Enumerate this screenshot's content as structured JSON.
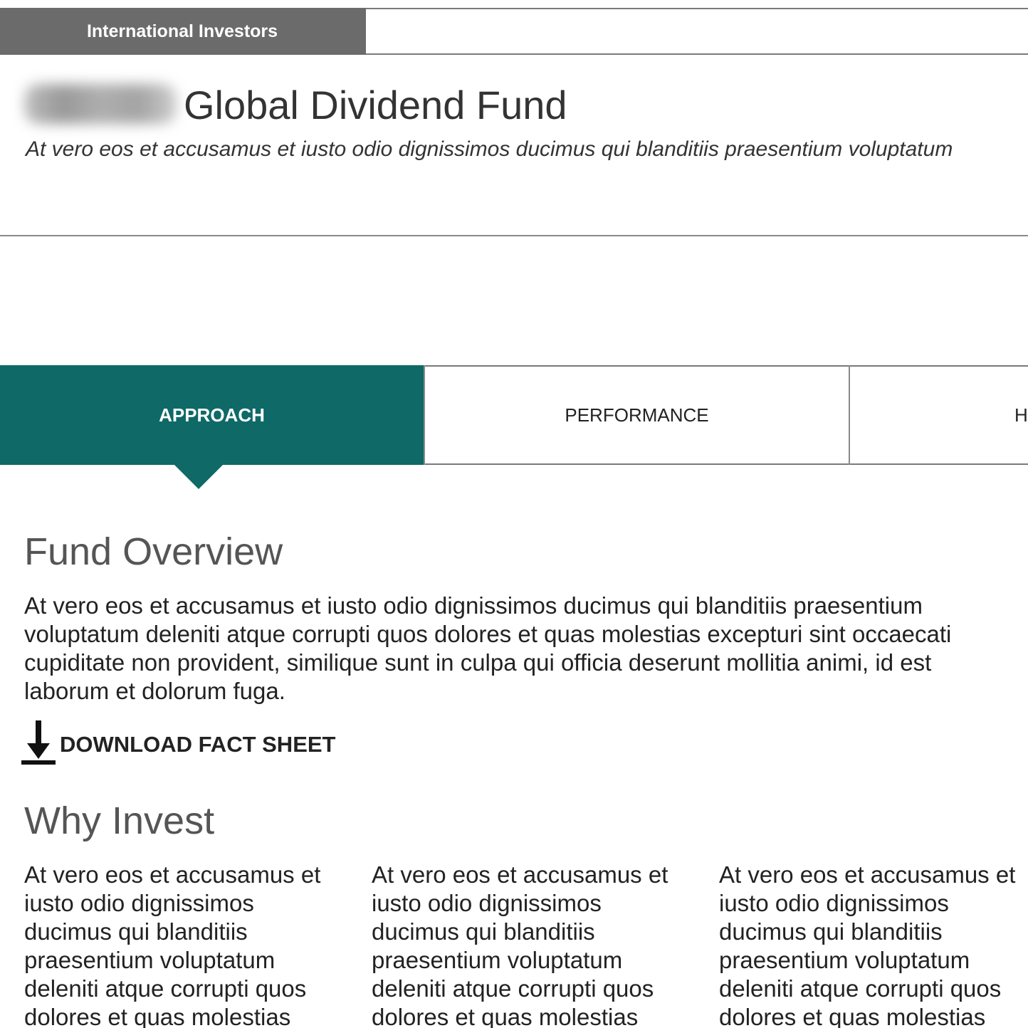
{
  "topbar": {
    "investor_tab_label": "International Investors"
  },
  "header": {
    "fund_title": "Global Dividend Fund",
    "subtitle": "At vero eos et accusamus et iusto odio dignissimos ducimus qui blanditiis praesentium voluptatum"
  },
  "tabs": [
    {
      "label": "APPROACH",
      "active": true
    },
    {
      "label": "PERFORMANCE",
      "active": false
    },
    {
      "label": "H",
      "active": false
    }
  ],
  "overview": {
    "heading": "Fund Overview",
    "text": "At vero eos et accusamus et iusto odio dignissimos ducimus qui blanditiis praesentium\nvoluptatum deleniti atque corrupti quos dolores et quas molestias excepturi sint occaecati\ncupiditate non provident, similique sunt in culpa qui officia deserunt mollitia animi, id est\nlaborum et dolorum fuga.",
    "download_label": "DOWNLOAD FACT SHEET",
    "download_icon": "download-arrow-icon"
  },
  "why_invest": {
    "heading": "Why Invest",
    "columns": [
      "At vero eos et accusamus et\niusto odio dignissimos\nducimus qui blanditiis\npraesentium voluptatum\ndeleniti atque corrupti quos\ndolores et quas molestias",
      "At vero eos et accusamus et\niusto odio dignissimos\nducimus qui blanditiis\npraesentium voluptatum\ndeleniti atque corrupti quos\ndolores et quas molestias",
      "At vero eos et accusamus et\niusto odio dignissimos\nducimus qui blanditiis\npraesentium voluptatum\ndeleniti atque corrupti quos\ndolores et quas molestias"
    ]
  },
  "colors": {
    "active_tab": "#0e6967",
    "topbar_tab": "#6b6b6b",
    "heading_gray": "#555555"
  }
}
